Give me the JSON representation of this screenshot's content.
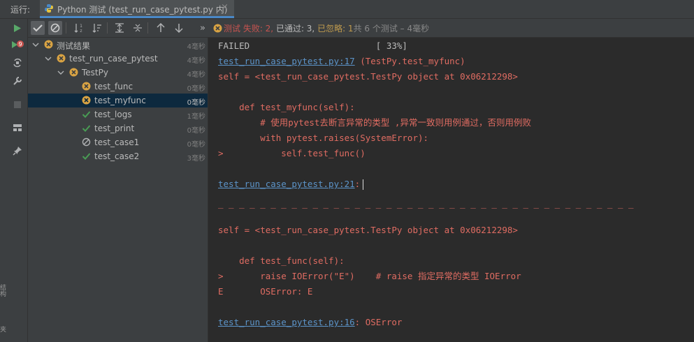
{
  "topbar": {
    "run_label": "运行:",
    "tab_title": "Python 测试 (test_run_case_pytest.py 内)",
    "tab_close": "×"
  },
  "left_strip": {
    "labels": [
      "结构",
      "收藏夹"
    ]
  },
  "toolbar": {
    "status_fail": "测试 失败: 2,",
    "status_pass": " 已通过: 3,",
    "status_ignored": " 已忽略: 1",
    "status_total": "共 6 个测试 – 4毫秒",
    "overflow": "»"
  },
  "tree": {
    "rows": [
      {
        "label": "测试结果",
        "time": "4毫秒",
        "status": "fail"
      },
      {
        "label": "test_run_case_pytest",
        "time": "4毫秒",
        "status": "fail"
      },
      {
        "label": "TestPy",
        "time": "4毫秒",
        "status": "fail"
      },
      {
        "label": "test_func",
        "time": "0毫秒",
        "status": "fail"
      },
      {
        "label": "test_myfunc",
        "time": "0毫秒",
        "status": "fail"
      },
      {
        "label": "test_logs",
        "time": "1毫秒",
        "status": "pass"
      },
      {
        "label": "test_print",
        "time": "0毫秒",
        "status": "pass"
      },
      {
        "label": "test_case1",
        "time": "0毫秒",
        "status": "ignored"
      },
      {
        "label": "test_case2",
        "time": "3毫秒",
        "status": "pass"
      }
    ]
  },
  "console": {
    "l1": "FAILED                        [ 33%]",
    "l2_link": "test_run_case_pytest.py:17",
    "l2_rest": " (TestPy.test_myfunc)",
    "l3": "self = <test_run_case_pytest.TestPy object at 0x06212298>",
    "l4": "    def test_myfunc(self):",
    "l5": "        # 使用pytest去断言异常的类型 ,异常一致则用例通过，否则用例败",
    "l6": "        with pytest.raises(SystemError):",
    "l7": ">           self.test_func()",
    "l8_link": "test_run_case_pytest.py:21",
    "l8_rest": ":",
    "l9": "_ _ _ _ _ _ _ _ _ _ _ _ _ _ _ _ _ _ _ _ _ _ _ _ _ _ _ _ _ _ _ _ _ _ _ _ _ _ _ _",
    "l10": "self = <test_run_case_pytest.TestPy object at 0x06212298>",
    "l11": "    def test_func(self):",
    "l12": ">       raise IOError(\"E\")    # raise 指定异常的类型 IOError",
    "l13": "E       OSError: E",
    "l14_link": "test_run_case_pytest.py:16",
    "l14_rest": ": OSError"
  },
  "colors": {
    "fail": "#c75450",
    "pass": "#499c54",
    "ignored": "#c09b4e",
    "link": "#5c94c9",
    "selection": "#0d293e"
  }
}
